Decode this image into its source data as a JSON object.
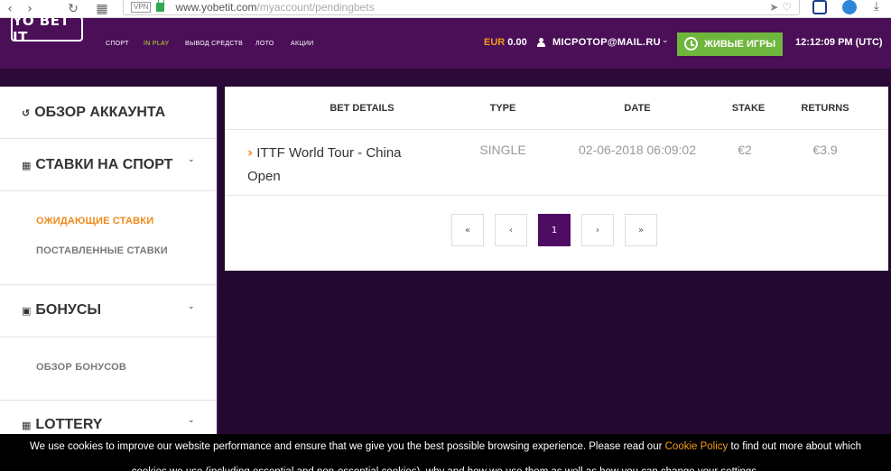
{
  "browser": {
    "vpn_label": "VPN",
    "url_domain": "www.yobetit.com",
    "url_path": "/myaccount/pendingbets"
  },
  "header": {
    "logo": "YO BET IT",
    "nav": [
      "СПОРТ",
      "IN PLAY",
      "ВЫВОД СРЕДСТВ",
      "ЛОТО",
      "АКЦИИ"
    ],
    "currency": "EUR",
    "balance": "0.00",
    "user": "MICPOTOP@MAIL.RU",
    "live_button": "ЖИВЫЕ ИГРЫ",
    "time": "12:12:09 PM (UTC)"
  },
  "sidebar": {
    "account_overview": "ОБЗОР АККАУНТА",
    "sports_bets": "СТАВКИ НА СПОРТ",
    "pending_bets": "ОЖИДАЮЩИЕ СТАВКИ",
    "placed_bets": "ПОСТАВЛЕННЫЕ СТАВКИ",
    "bonuses": "БОНУСЫ",
    "bonus_overview": "ОБЗОР БОНУСОВ",
    "lottery": "LOTTERY"
  },
  "table": {
    "headers": [
      "BET DETAILS",
      "TYPE",
      "DATE",
      "STAKE",
      "RETURNS"
    ],
    "rows": [
      {
        "event": "ITTF World Tour - China Open",
        "type": "SINGLE",
        "date": "02-06-2018 06:09:02",
        "stake": "€2",
        "returns": "€3.9"
      }
    ]
  },
  "pagination": {
    "first": "«",
    "prev": "‹",
    "current": "1",
    "next": "›",
    "last": "»"
  },
  "cookie": {
    "text_before": "We use cookies to improve our website performance and ensure that we give you the best possible browsing experience. Please read our ",
    "link": "Cookie Policy",
    "text_after": " to find out more about which",
    "line2": "cookies we use (including essential and non-essential cookies), why and how we use them as well as how you can change your settings."
  },
  "colors": {
    "header_bg": "#4a0f57",
    "page_bg": "#23082f",
    "accent_orange": "#ef8a17",
    "live_green": "#6fb63d",
    "inplay_green": "#b6e32c"
  }
}
